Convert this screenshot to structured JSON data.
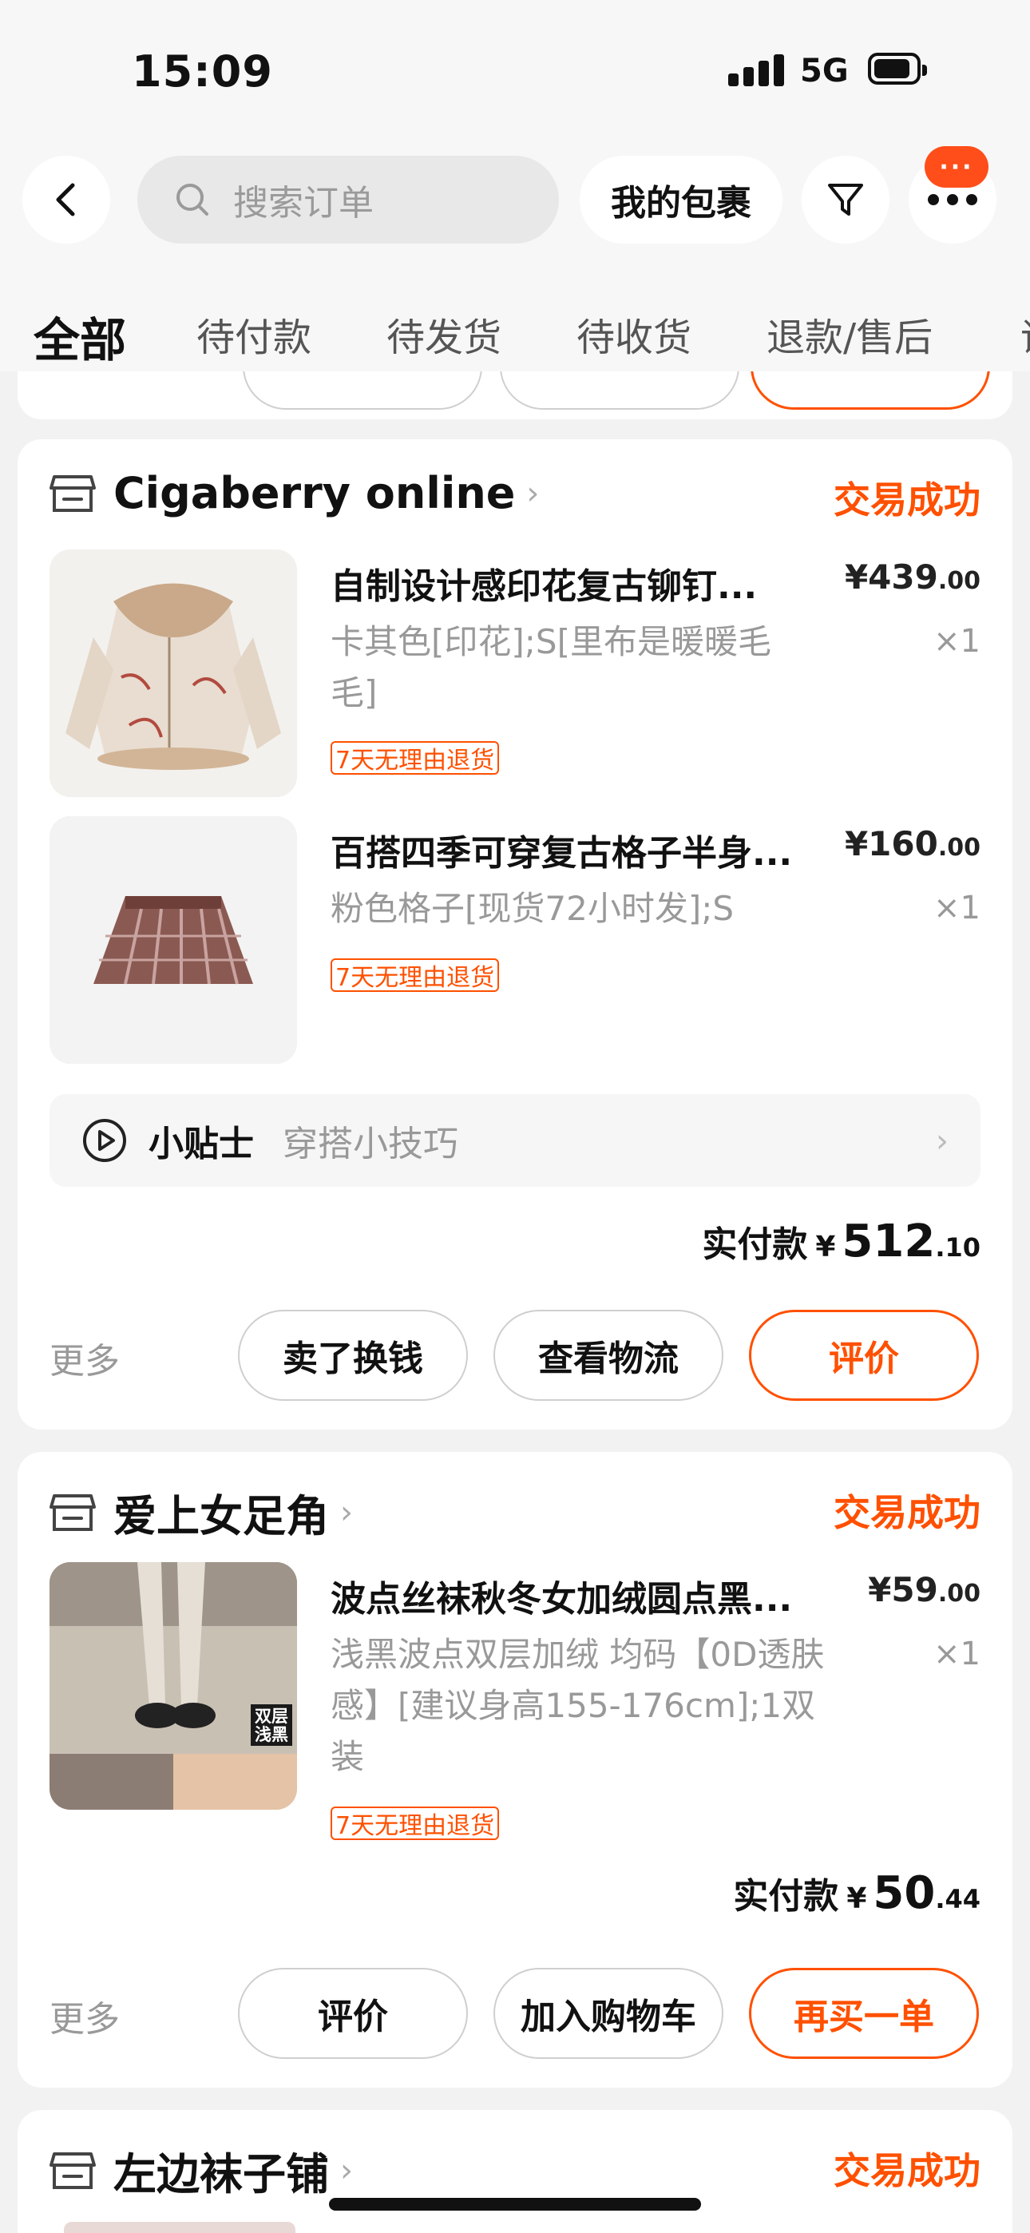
{
  "status_bar": {
    "time": "15:09",
    "network": "5G"
  },
  "header": {
    "search_placeholder": "搜索订单",
    "packages_label": "我的包裹",
    "message_badge": "···"
  },
  "tabs": [
    "全部",
    "待付款",
    "待发货",
    "待收货",
    "退款/售后",
    "评"
  ],
  "orders": [
    {
      "shop": "Cigaberry online",
      "status": "交易成功",
      "items": [
        {
          "title": "自制设计感印花复古铆钉...",
          "spec": "卡其色[印花];S[里布是暖暖毛毛]",
          "price_int": "¥439",
          "price_dec": ".00",
          "qty": "×1",
          "tag": "7天无理由退货"
        },
        {
          "title": "百搭四季可穿复古格子半身...",
          "spec": "粉色格子[现货72小时发];S",
          "price_int": "¥160",
          "price_dec": ".00",
          "qty": "×1",
          "tag": "7天无理由退货"
        }
      ],
      "tips": {
        "title": "小贴士",
        "subtitle": "穿搭小技巧"
      },
      "total": {
        "label": "实付款",
        "yen": "¥",
        "int": "512",
        "dec": ".10"
      },
      "more": "更多",
      "buttons": [
        "卖了换钱",
        "查看物流",
        "评价"
      ]
    },
    {
      "shop": "爱上女足角",
      "status": "交易成功",
      "items": [
        {
          "title": "波点丝袜秋冬女加绒圆点黑...",
          "spec": "浅黑波点双层加绒 均码【0D透肤感】[建议身高155-176cm];1双装",
          "price_int": "¥59",
          "price_dec": ".00",
          "qty": "×1",
          "tag": "7天无理由退货",
          "image_label": "双层浅黑"
        }
      ],
      "total": {
        "label": "实付款",
        "yen": "¥",
        "int": "50",
        "dec": ".44"
      },
      "more": "更多",
      "buttons": [
        "评价",
        "加入购物车",
        "再买一单"
      ]
    },
    {
      "shop": "左边袜子铺",
      "status": "交易成功"
    }
  ],
  "colors": {
    "accent": "#ff5000",
    "badge": "#ff4e1a",
    "background": "#f2f2f2"
  }
}
